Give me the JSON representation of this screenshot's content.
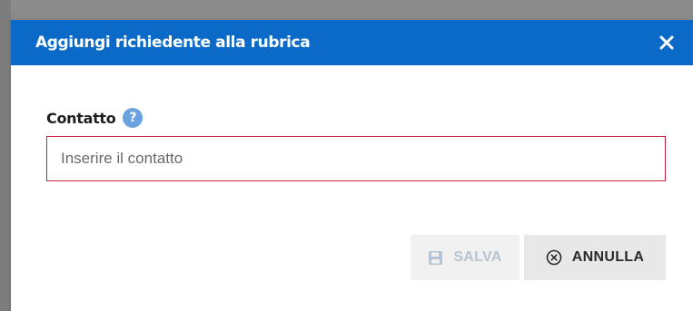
{
  "dialog": {
    "title": "Aggiungi richiedente alla rubrica",
    "close_icon": "close-icon"
  },
  "form": {
    "contact_label": "Contatto",
    "help_icon": "question-circle-icon",
    "help_glyph": "?",
    "contact_placeholder": "Inserire il contatto",
    "contact_value": ""
  },
  "actions": {
    "save_label": "SALVA",
    "save_icon": "floppy-disk-icon",
    "save_disabled": true,
    "cancel_label": "ANNULLA",
    "cancel_icon": "close-circle-icon"
  },
  "colors": {
    "header_bg": "#0b69c7",
    "input_border_error": "#c7243a",
    "help_icon_bg": "#6aa3e0",
    "save_disabled_text": "#b7c4d2",
    "cancel_bg": "#e8e8e8"
  }
}
